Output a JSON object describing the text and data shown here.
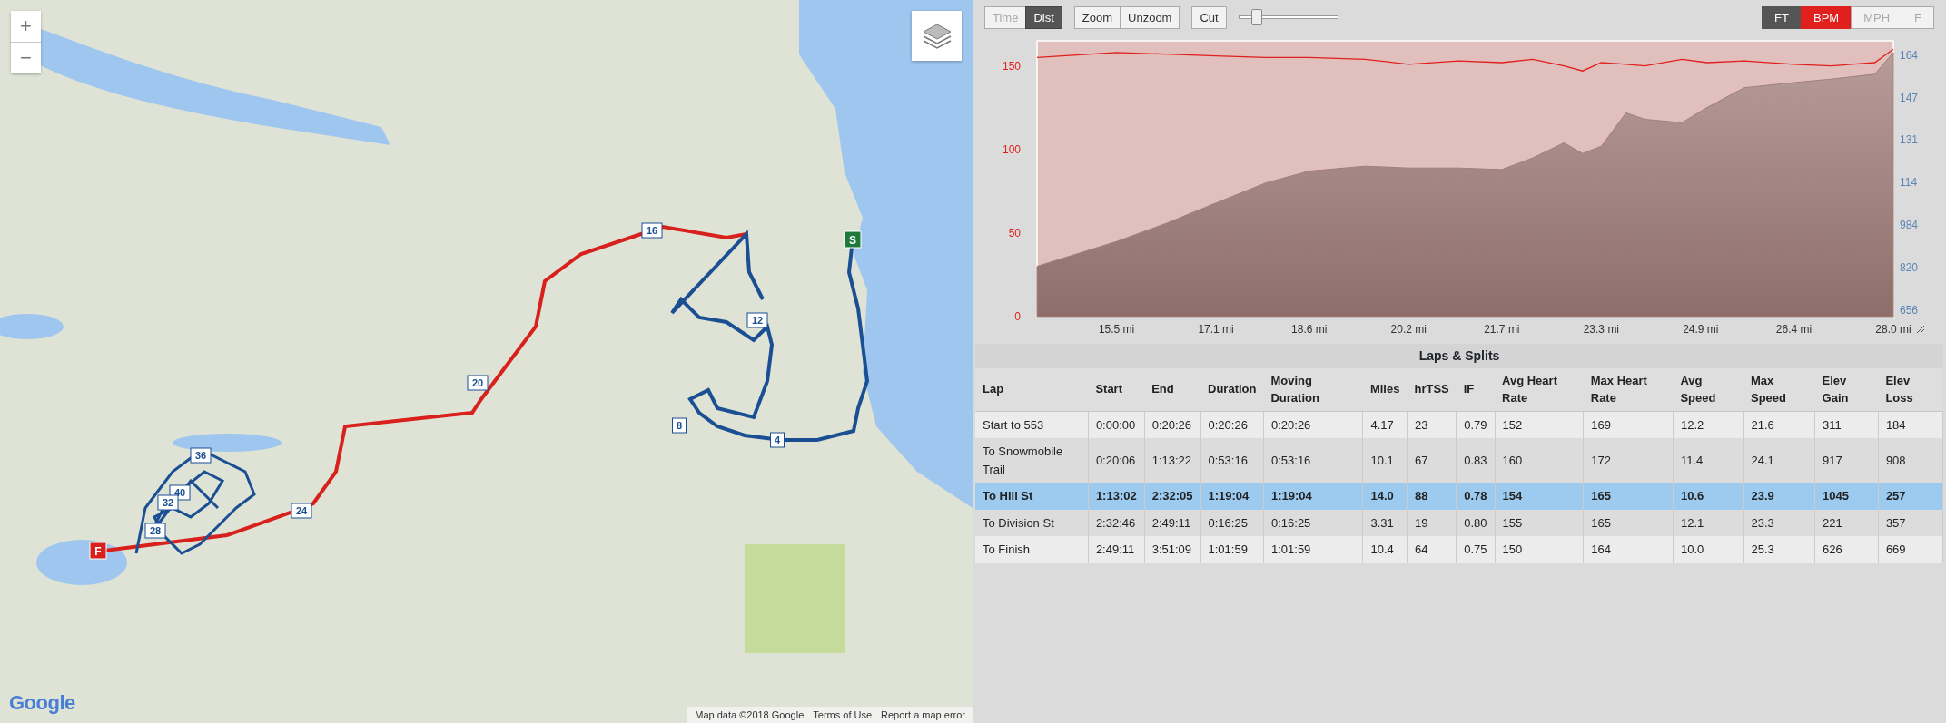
{
  "map": {
    "zoom_in": "+",
    "zoom_out": "−",
    "logo": "Google",
    "start_marker": "S",
    "finish_marker": "F",
    "mile_markers": [
      "16",
      "20",
      "24",
      "12",
      "8",
      "4",
      "36",
      "40",
      "32",
      "28"
    ],
    "attribution": [
      "Map data ©2018 Google",
      "Terms of Use",
      "Report a map error"
    ]
  },
  "toolbar": {
    "x_axis_toggle": [
      {
        "label": "Time",
        "selected": false
      },
      {
        "label": "Dist",
        "selected": true
      }
    ],
    "zoom_buttons": [
      "Zoom",
      "Unzoom"
    ],
    "cut_button": "Cut",
    "slider": {
      "level": 0.15
    },
    "series_toggle": [
      {
        "label": "FT",
        "selected": true,
        "color": "#555555"
      },
      {
        "label": "BPM",
        "selected": true,
        "color": "#e0201c"
      },
      {
        "label": "MPH",
        "selected": false
      },
      {
        "label": "F",
        "selected": false
      }
    ]
  },
  "chart": {
    "chart_data": {
      "type": "line",
      "x": [
        14.22,
        15.5,
        16.3,
        17.1,
        17.9,
        18.6,
        19.5,
        20.2,
        21.0,
        21.7,
        22.2,
        22.7,
        23.0,
        23.3,
        23.7,
        24.0,
        24.6,
        25.0,
        25.6,
        26.4,
        27.0,
        27.7,
        28.0
      ],
      "xlim": [
        14.22,
        28.0
      ],
      "xticks": [
        {
          "value": 15.5,
          "label": "15.5 mi"
        },
        {
          "value": 17.1,
          "label": "17.1 mi"
        },
        {
          "value": 18.6,
          "label": "18.6 mi"
        },
        {
          "value": 20.2,
          "label": "20.2 mi"
        },
        {
          "value": 21.7,
          "label": "21.7 mi"
        },
        {
          "value": 23.3,
          "label": "23.3 mi"
        },
        {
          "value": 24.9,
          "label": "24.9 mi"
        },
        {
          "value": 26.4,
          "label": "26.4 mi"
        },
        {
          "value": 28.0,
          "label": "28.0 mi"
        }
      ],
      "ylim": [
        0,
        165
      ],
      "yticks": [
        0,
        50,
        100,
        150
      ],
      "y2lim": [
        630,
        1695
      ],
      "y2ticks": [
        656,
        820,
        984
      ],
      "series": [
        {
          "color": "#e0201c",
          "values": [
            155,
            158,
            157,
            156,
            155,
            155,
            154,
            151,
            153,
            152,
            154,
            150,
            147,
            152,
            151,
            150,
            154,
            152,
            153,
            151,
            150,
            152,
            160
          ]
        },
        {
          "type": "area",
          "color": "#a07e7b",
          "axis": "y2",
          "values": [
            824,
            920,
            990,
            1069,
            1146,
            1192,
            1211,
            1204,
            1204,
            1198,
            1243,
            1301,
            1260,
            1288,
            1417,
            1392,
            1379,
            1437,
            1514,
            1534,
            1547,
            1566,
            1650
          ]
        }
      ]
    },
    "right_axis_cut_labels": [
      "164",
      "147",
      "131",
      "114"
    ]
  },
  "laps": {
    "title": "Laps & Splits",
    "columns": [
      "Lap",
      "Start",
      "End",
      "Duration",
      "Moving Duration",
      "Miles",
      "hrTSS",
      "IF",
      "Avg Heart Rate",
      "Max Heart Rate",
      "Avg Speed",
      "Max Speed",
      "Elev Gain",
      "Elev Loss"
    ],
    "rows": [
      {
        "selected": false,
        "cells": [
          "Start to 553",
          "0:00:00",
          "0:20:26",
          "0:20:26",
          "0:20:26",
          "4.17",
          "23",
          "0.79",
          "152",
          "169",
          "12.2",
          "21.6",
          "311",
          "184"
        ]
      },
      {
        "selected": false,
        "cells": [
          "To Snowmobile Trail",
          "0:20:06",
          "1:13:22",
          "0:53:16",
          "0:53:16",
          "10.1",
          "67",
          "0.83",
          "160",
          "172",
          "11.4",
          "24.1",
          "917",
          "908"
        ]
      },
      {
        "selected": true,
        "cells": [
          "To Hill St",
          "1:13:02",
          "2:32:05",
          "1:19:04",
          "1:19:04",
          "14.0",
          "88",
          "0.78",
          "154",
          "165",
          "10.6",
          "23.9",
          "1045",
          "257"
        ]
      },
      {
        "selected": false,
        "cells": [
          "To Division St",
          "2:32:46",
          "2:49:11",
          "0:16:25",
          "0:16:25",
          "3.31",
          "19",
          "0.80",
          "155",
          "165",
          "12.1",
          "23.3",
          "221",
          "357"
        ]
      },
      {
        "selected": false,
        "cells": [
          "To Finish",
          "2:49:11",
          "3:51:09",
          "1:01:59",
          "1:01:59",
          "10.4",
          "64",
          "0.75",
          "150",
          "164",
          "10.0",
          "25.3",
          "626",
          "669"
        ]
      }
    ]
  }
}
